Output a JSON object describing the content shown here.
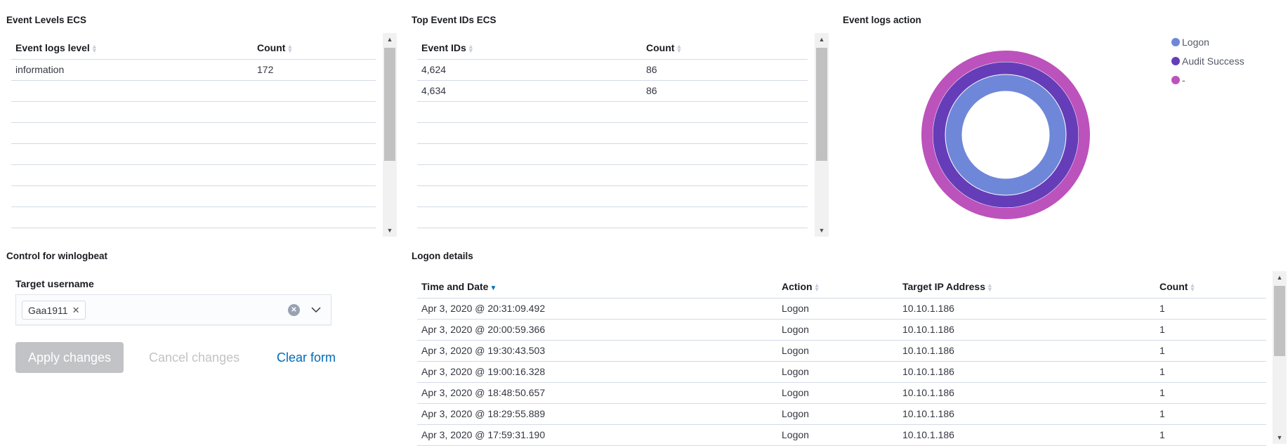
{
  "panels": {
    "event_levels": {
      "title": "Event Levels ECS",
      "columns": [
        "Event logs level",
        "Count"
      ],
      "rows": [
        [
          "information",
          "172"
        ]
      ]
    },
    "top_event_ids": {
      "title": "Top Event IDs ECS",
      "columns": [
        "Event IDs",
        "Count"
      ],
      "rows": [
        [
          "4,624",
          "86"
        ],
        [
          "4,634",
          "86"
        ]
      ]
    },
    "event_logs_action": {
      "title": "Event logs action",
      "legend": [
        {
          "label": "Logon",
          "color": "#6f87d8"
        },
        {
          "label": "Audit Success",
          "color": "#663db8"
        },
        {
          "label": "-",
          "color": "#bc52bc"
        }
      ]
    },
    "control": {
      "title": "Control for winlogbeat",
      "field_label": "Target username",
      "selected_value": "Gaa1911",
      "apply_label": "Apply changes",
      "cancel_label": "Cancel changes",
      "clear_label": "Clear form"
    },
    "logon_details": {
      "title": "Logon details",
      "columns": [
        "Time and Date",
        "Action",
        "Target IP Address",
        "Count"
      ],
      "sorted_column": "Time and Date",
      "sort_direction": "descending",
      "rows": [
        [
          "Apr 3, 2020 @ 20:31:09.492",
          "Logon",
          "10.10.1.186",
          "1"
        ],
        [
          "Apr 3, 2020 @ 20:00:59.366",
          "Logon",
          "10.10.1.186",
          "1"
        ],
        [
          "Apr 3, 2020 @ 19:30:43.503",
          "Logon",
          "10.10.1.186",
          "1"
        ],
        [
          "Apr 3, 2020 @ 19:00:16.328",
          "Logon",
          "10.10.1.186",
          "1"
        ],
        [
          "Apr 3, 2020 @ 18:48:50.657",
          "Logon",
          "10.10.1.186",
          "1"
        ],
        [
          "Apr 3, 2020 @ 18:29:55.889",
          "Logon",
          "10.10.1.186",
          "1"
        ],
        [
          "Apr 3, 2020 @ 17:59:31.190",
          "Logon",
          "10.10.1.186",
          "1"
        ]
      ]
    }
  }
}
